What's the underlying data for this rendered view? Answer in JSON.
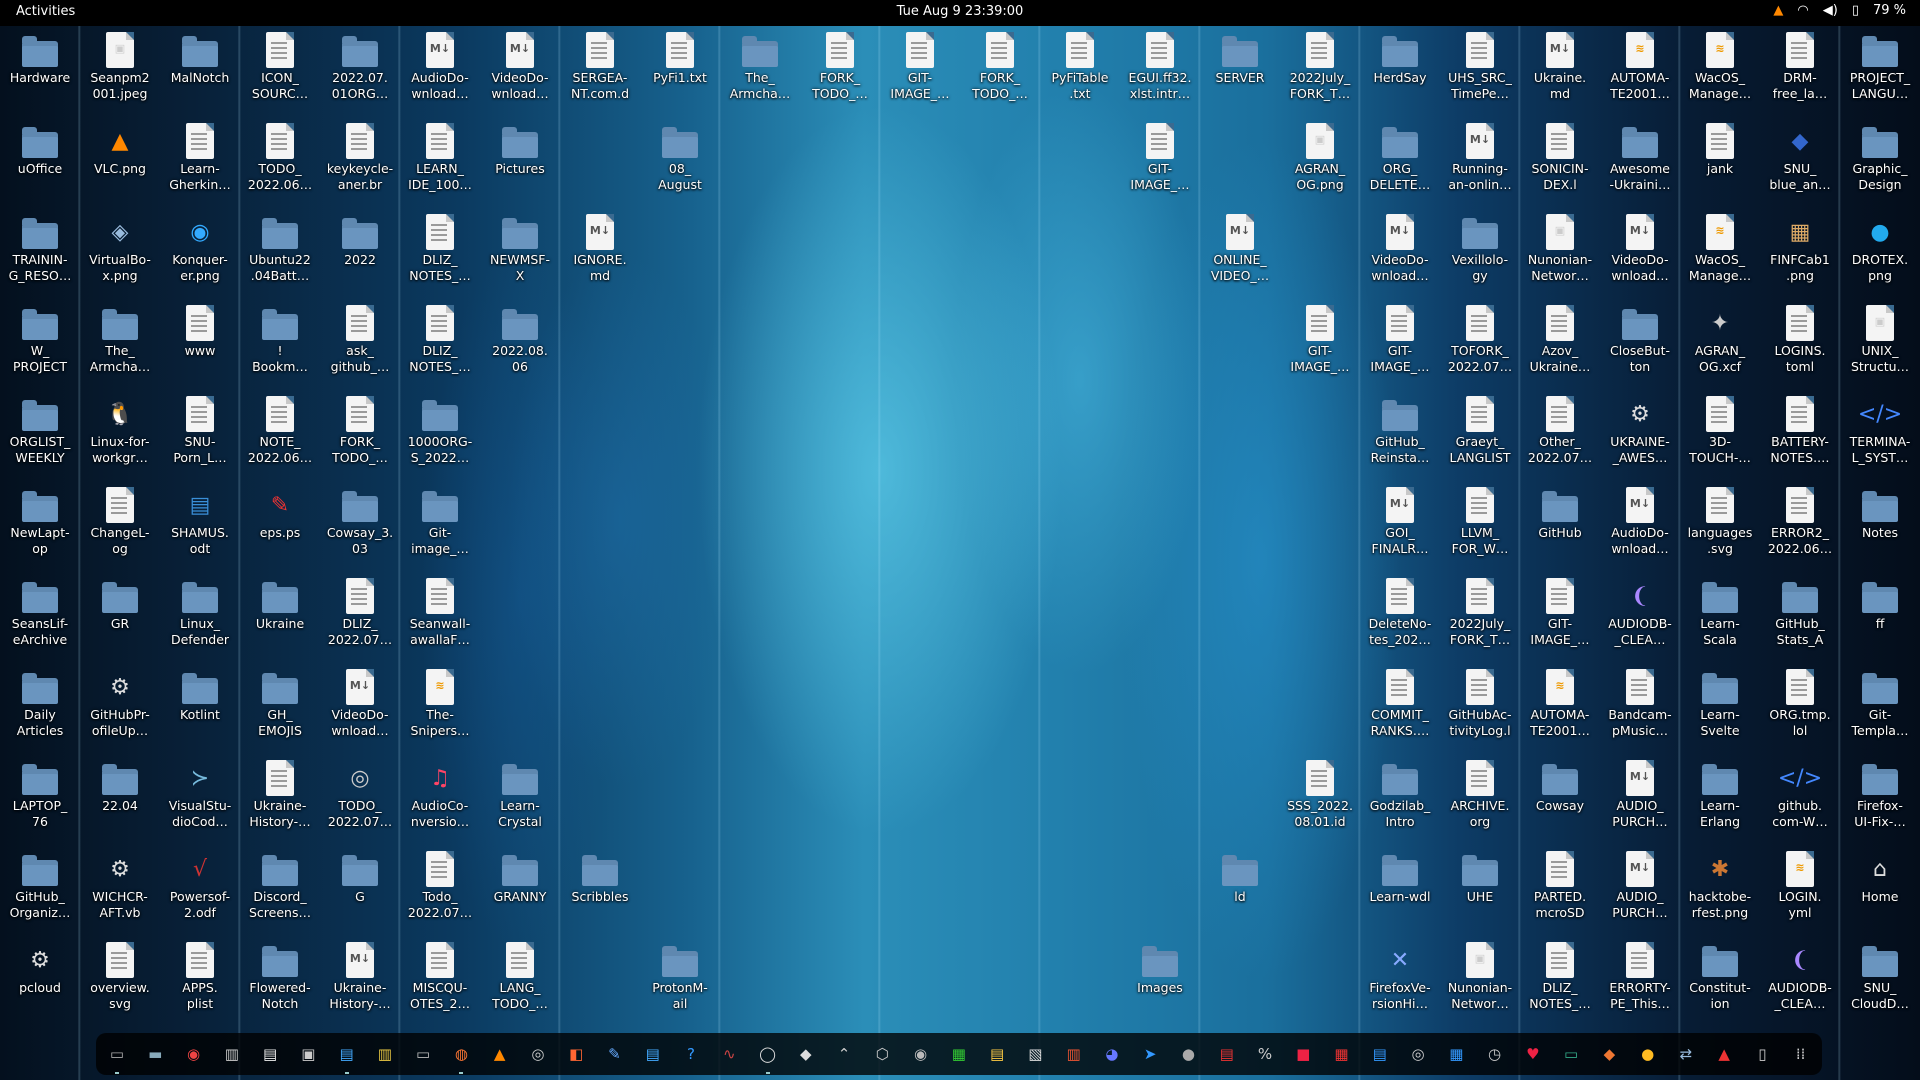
{
  "topbar": {
    "activities": "Activities",
    "clock": "Tue Aug 9  23:39:00",
    "battery": "79 %",
    "icons": [
      "vlc-tray-icon",
      "wifi-icon",
      "volume-icon",
      "battery-icon"
    ]
  },
  "desktop": {
    "columns": [
      [
        [
          "Hardware",
          "folder"
        ],
        [
          "uOffice",
          "folder"
        ],
        [
          "TRAININ-\nG_RESO…",
          "folder"
        ],
        [
          "W_\nPROJECT",
          "folder"
        ],
        [
          "ORGLIST_\nWEEKLY",
          "folder"
        ],
        [
          "NewLapt-\nop",
          "folder"
        ],
        [
          "SeansLif-\neArchive",
          "folder"
        ],
        [
          "Daily\nArticles",
          "folder"
        ],
        [
          "LAPTOP_\n76",
          "folder"
        ],
        [
          "GitHub_\nOrganiz…",
          "folder"
        ],
        [
          "pcloud",
          "gear"
        ]
      ],
      [
        [
          "Seanpm2\n001.jpeg",
          "image"
        ],
        [
          "VLC.png",
          "vlc"
        ],
        [
          "VirtualBo-\nx.png",
          "box"
        ],
        [
          "The_\nArmcha…",
          "folder"
        ],
        [
          "Linux-for-\nworkgr…",
          "tux"
        ],
        [
          "ChangeL-\nog",
          "doc"
        ],
        [
          "GR",
          "folder"
        ],
        [
          "GitHubPr-\nofileUp…",
          "gear"
        ],
        [
          "22.04",
          "folder"
        ],
        [
          "WICHCR-\nAFT.vb",
          "gear"
        ],
        [
          "overview.\nsvg",
          "doc"
        ]
      ],
      [
        [
          "MalNotch",
          "folder"
        ],
        [
          "Learn-\nGherkin…",
          "doc"
        ],
        [
          "Konquer-\ner.png",
          "globe"
        ],
        [
          "www",
          "doc"
        ],
        [
          "SNU-\nPorn_L…",
          "doc"
        ],
        [
          "SHAMUS.\nodt",
          "writer"
        ],
        [
          "Linux_\nDefender",
          "folder"
        ],
        [
          "Kotlint",
          "folder"
        ],
        [
          "VisualStu-\ndioCod…",
          "vscode"
        ],
        [
          "Powersof-\n2.odf",
          "formula"
        ],
        [
          "APPS.\nplist",
          "doc"
        ]
      ],
      [
        [
          "ICON_\nSOURC…",
          "doc"
        ],
        [
          "TODO_\n2022.06…",
          "doc"
        ],
        [
          "Ubuntu22\n.04Batt…",
          "folder"
        ],
        [
          "!\nBookm…",
          "folder"
        ],
        [
          "NOTE_\n2022.06…",
          "doc"
        ],
        [
          "eps.ps",
          "eps"
        ],
        [
          "Ukraine",
          "folder"
        ],
        [
          "GH_\nEMOJIS",
          "folder"
        ],
        [
          "Ukraine-\nHistory-…",
          "doc"
        ],
        [
          "Discord_\nScreens…",
          "folder"
        ],
        [
          "Flowered-\nNotch",
          "folder"
        ]
      ],
      [
        [
          "2022.07.\n01ORG…",
          "folder"
        ],
        [
          "keykeycle-\naner.br",
          "doc"
        ],
        [
          "2022",
          "folder"
        ],
        [
          "ask_\ngithub_…",
          "doc"
        ],
        [
          "FORK_\nTODO_…",
          "doc"
        ],
        [
          "Cowsay_3.\n03",
          "folder"
        ],
        [
          "DLIZ_\n2022.07…",
          "doc"
        ],
        [
          "VideoDo-\nwnload…",
          "md"
        ],
        [
          "TODO_\n2022.07…",
          "disc"
        ],
        [
          "G",
          "folder"
        ],
        [
          "Ukraine-\nHistory-…",
          "md"
        ]
      ],
      [
        [
          "AudioDo-\nwnload…",
          "md"
        ],
        [
          "LEARN_\nIDE_100…",
          "doc"
        ],
        [
          "DLIZ_\nNOTES_…",
          "doc"
        ],
        [
          "DLIZ_\nNOTES_…",
          "doc"
        ],
        [
          "1000ORG-\nS_2022…",
          "folder"
        ],
        [
          "Git-\nimage_…",
          "folder"
        ],
        [
          "Seanwall-\nawallaF…",
          "doc"
        ],
        [
          "The-\nSnipers…",
          "yaml"
        ],
        [
          "AudioCo-\nnversio…",
          "music"
        ],
        [
          "Todo_\n2022.07…",
          "doc"
        ],
        [
          "MISCQU-\nOTES_2…",
          "doc"
        ]
      ],
      [
        [
          "VideoDo-\nwnload…",
          "md"
        ],
        [
          "Pictures",
          "folder"
        ],
        [
          "NEWMSF-\nX",
          "folder"
        ],
        [
          "2022.08.\n06",
          "folder"
        ],
        null,
        null,
        null,
        null,
        [
          "Learn-\nCrystal",
          "folder"
        ],
        [
          "GRANNY",
          "folder"
        ],
        [
          "LANG_\nTODO_…",
          "doc"
        ]
      ],
      [
        [
          "SERGEA-\nNT.com.d",
          "doc"
        ],
        null,
        [
          "IGNORE.\nmd",
          "md"
        ],
        null,
        null,
        null,
        null,
        null,
        null,
        [
          "Scribbles",
          "folder"
        ],
        null
      ],
      [
        [
          "PyFi1.txt",
          "doc"
        ],
        [
          "08_\nAugust",
          "folder"
        ],
        null,
        null,
        null,
        null,
        null,
        null,
        null,
        null,
        [
          "ProtonM-\nail",
          "folder"
        ]
      ],
      [
        [
          "The_\nArmcha…",
          "folder"
        ],
        null,
        null,
        null,
        null,
        null,
        null,
        null,
        null,
        null,
        null
      ],
      [
        [
          "FORK_\nTODO_…",
          "doc"
        ],
        null,
        null,
        null,
        null,
        null,
        null,
        null,
        null,
        null,
        null
      ],
      [
        [
          "GIT-\nIMAGE_…",
          "doc"
        ],
        null,
        null,
        null,
        null,
        null,
        null,
        null,
        null,
        null,
        null
      ],
      [
        [
          "FORK_\nTODO_…",
          "doc"
        ],
        null,
        null,
        null,
        null,
        null,
        null,
        null,
        null,
        null,
        null
      ],
      [
        [
          "PyFiTable\n.txt",
          "doc"
        ],
        null,
        null,
        null,
        null,
        null,
        null,
        null,
        null,
        null,
        null
      ],
      [
        [
          "EGUI.ff32.\nxlst.intr…",
          "doc"
        ],
        [
          "GIT-\nIMAGE_…",
          "doc"
        ],
        null,
        null,
        null,
        null,
        null,
        null,
        null,
        null,
        [
          "Images",
          "folder"
        ]
      ],
      [
        [
          "SERVER",
          "folder"
        ],
        null,
        [
          "ONLINE_\nVIDEO_…",
          "md"
        ],
        null,
        null,
        null,
        null,
        null,
        null,
        [
          "ld",
          "folder"
        ],
        null
      ],
      [
        [
          "2022July_\nFORK_T…",
          "doc"
        ],
        [
          "AGRAN_\nOG.png",
          "image"
        ],
        null,
        [
          "GIT-\nIMAGE_…",
          "doc"
        ],
        null,
        null,
        null,
        null,
        [
          "SSS_2022.\n08.01.id",
          "doc"
        ],
        null,
        null
      ],
      [
        [
          "HerdSay",
          "folder"
        ],
        [
          "ORG_\nDELETE…",
          "folder"
        ],
        [
          "VideoDo-\nwnload…",
          "md"
        ],
        [
          "GIT-\nIMAGE_…",
          "doc"
        ],
        [
          "GitHub_\nReinsta…",
          "folder"
        ],
        [
          "GOI_\nFINALR…",
          "md"
        ],
        [
          "DeleteNo-\ntes_202…",
          "doc"
        ],
        [
          "COMMIT_\nRANKS.…",
          "doc"
        ],
        [
          "Godzilab_\nIntro",
          "folder"
        ],
        [
          "Learn-wdl",
          "folder"
        ],
        [
          "FirefoxVe-\nrsionHi…",
          "xfig"
        ]
      ],
      [
        [
          "UHS_SRC_\nTimePe…",
          "doc"
        ],
        [
          "Running-\nan-onlin…",
          "md"
        ],
        [
          "Vexillolo-\ngy",
          "folder"
        ],
        [
          "TOFORK_\n2022.07…",
          "doc"
        ],
        [
          "Graeyt_\nLANGLIST",
          "doc"
        ],
        [
          "LLVM_\nFOR_W…",
          "doc"
        ],
        [
          "2022July_\nFORK_T…",
          "doc"
        ],
        [
          "GitHubAc-\ntivityLog.l",
          "doc"
        ],
        [
          "ARCHIVE.\norg",
          "doc"
        ],
        [
          "UHE",
          "folder"
        ],
        [
          "Nunonian-\nNetwor…",
          "image"
        ]
      ],
      [
        [
          "Ukraine.\nmd",
          "md"
        ],
        [
          "SONICIN-\nDEX.l",
          "doc"
        ],
        [
          "Nunonian-\nNetwor…",
          "image"
        ],
        [
          "Azov_\nUkraine…",
          "doc"
        ],
        [
          "Other_\n2022.07…",
          "doc"
        ],
        [
          "GitHub",
          "folder"
        ],
        [
          "GIT-\nIMAGE_…",
          "doc"
        ],
        [
          "AUTOMA-\nTE2001…",
          "yaml"
        ],
        [
          "Cowsay",
          "folder"
        ],
        [
          "PARTED.\nmcroSD",
          "doc"
        ],
        [
          "DLIZ_\nNOTES_…",
          "doc"
        ]
      ],
      [
        [
          "AUTOMA-\nTE2001…",
          "yaml"
        ],
        [
          "Awesome\n-Ukraini…",
          "folder"
        ],
        [
          "VideoDo-\nwnload…",
          "md"
        ],
        [
          "CloseBut-\nton",
          "folder"
        ],
        [
          "UKRAINE-\n_AWES…",
          "gear"
        ],
        [
          "AudioDo-\nwnload…",
          "md"
        ],
        [
          "AUDIODB-\n_CLEA…",
          "pdb"
        ],
        [
          "Bandcam-\npMusic…",
          "doc"
        ],
        [
          "AUDIO_\nPURCH…",
          "md"
        ],
        [
          "AUDIO_\nPURCH…",
          "md"
        ],
        [
          "ERRORTY-\nPE_This…",
          "doc"
        ]
      ],
      [
        [
          "WacOS_\nManage…",
          "yaml"
        ],
        [
          "jank",
          "doc"
        ],
        [
          "WacOS_\nManage…",
          "yaml"
        ],
        [
          "AGRAN_\nOG.xcf",
          "gimp"
        ],
        [
          "3D-\nTOUCH-…",
          "doc"
        ],
        [
          "languages\n.svg",
          "doc"
        ],
        [
          "Learn-\nScala",
          "folder"
        ],
        [
          "Learn-\nSvelte",
          "folder"
        ],
        [
          "Learn-\nErlang",
          "folder"
        ],
        [
          "hacktobe-\nrfest.png",
          "hack"
        ],
        [
          "Constitut-\nion",
          "folder"
        ]
      ],
      [
        [
          "DRM-\nfree_la…",
          "doc"
        ],
        [
          "SNU_\nblue_an…",
          "snu"
        ],
        [
          "FINFCab1\n.png",
          "cabinet"
        ],
        [
          "LOGINS.\ntoml",
          "doc"
        ],
        [
          "BATTERY-\nNOTES.…",
          "doc"
        ],
        [
          "ERROR2_\n2022.06…",
          "doc"
        ],
        [
          "GitHub_\nStats_A",
          "folder"
        ],
        [
          "ORG.tmp.\nlol",
          "doc"
        ],
        [
          "github.\ncom-W…",
          "code"
        ],
        [
          "LOGIN.\nyml",
          "yaml"
        ],
        [
          "AUDIODB-\n_CLEA…",
          "pdb"
        ]
      ],
      [
        [
          "PROJECT_\nLANGU…",
          "folder"
        ],
        [
          "Graphic_\nDesign",
          "folder"
        ],
        [
          "DROTEX.\npng",
          "drop"
        ],
        [
          "UNIX_\nStructu…",
          "image"
        ],
        [
          "TERMINA-\nL_SYST…",
          "code"
        ],
        [
          "Notes",
          "folder"
        ],
        [
          "ff",
          "folder"
        ],
        [
          "Git-\nTempla…",
          "folder"
        ],
        [
          "Firefox-\nUI-Fix-…",
          "folder"
        ],
        [
          "Home",
          "home"
        ],
        [
          "SNU_\nCloudD…",
          "folder"
        ]
      ]
    ]
  },
  "dock": {
    "items": [
      "terminal-icon",
      "files-icon",
      "chrome-icon",
      "document-viewer-icon",
      "text-editor-icon",
      "screenshot-icon",
      "writer-icon",
      "notes-icon",
      "console-icon",
      "firefox-icon",
      "vlc-icon",
      "obs-icon",
      "software-center-icon",
      "draw-icon",
      "documents-icon",
      "help-icon",
      "system-monitor-icon",
      "settings-circle-icon",
      "shell-icon",
      "chevron-up-icon",
      "cube-icon",
      "camera-icon",
      "calc-icon",
      "calendar-icon",
      "archive-icon",
      "package-icon",
      "discord-icon",
      "telegram-icon",
      "tor-icon",
      "pdf-icon",
      "percent-icon",
      "record-icon",
      "grid-app-icon",
      "sheets-icon",
      "circle-app-icon",
      "tiles-icon",
      "clock-icon",
      "heart-icon",
      "terminal2-icon",
      "game-icon",
      "chat-icon",
      "arrows-icon",
      "flag-icon",
      "tablet-icon",
      "app-grid-icon"
    ]
  }
}
